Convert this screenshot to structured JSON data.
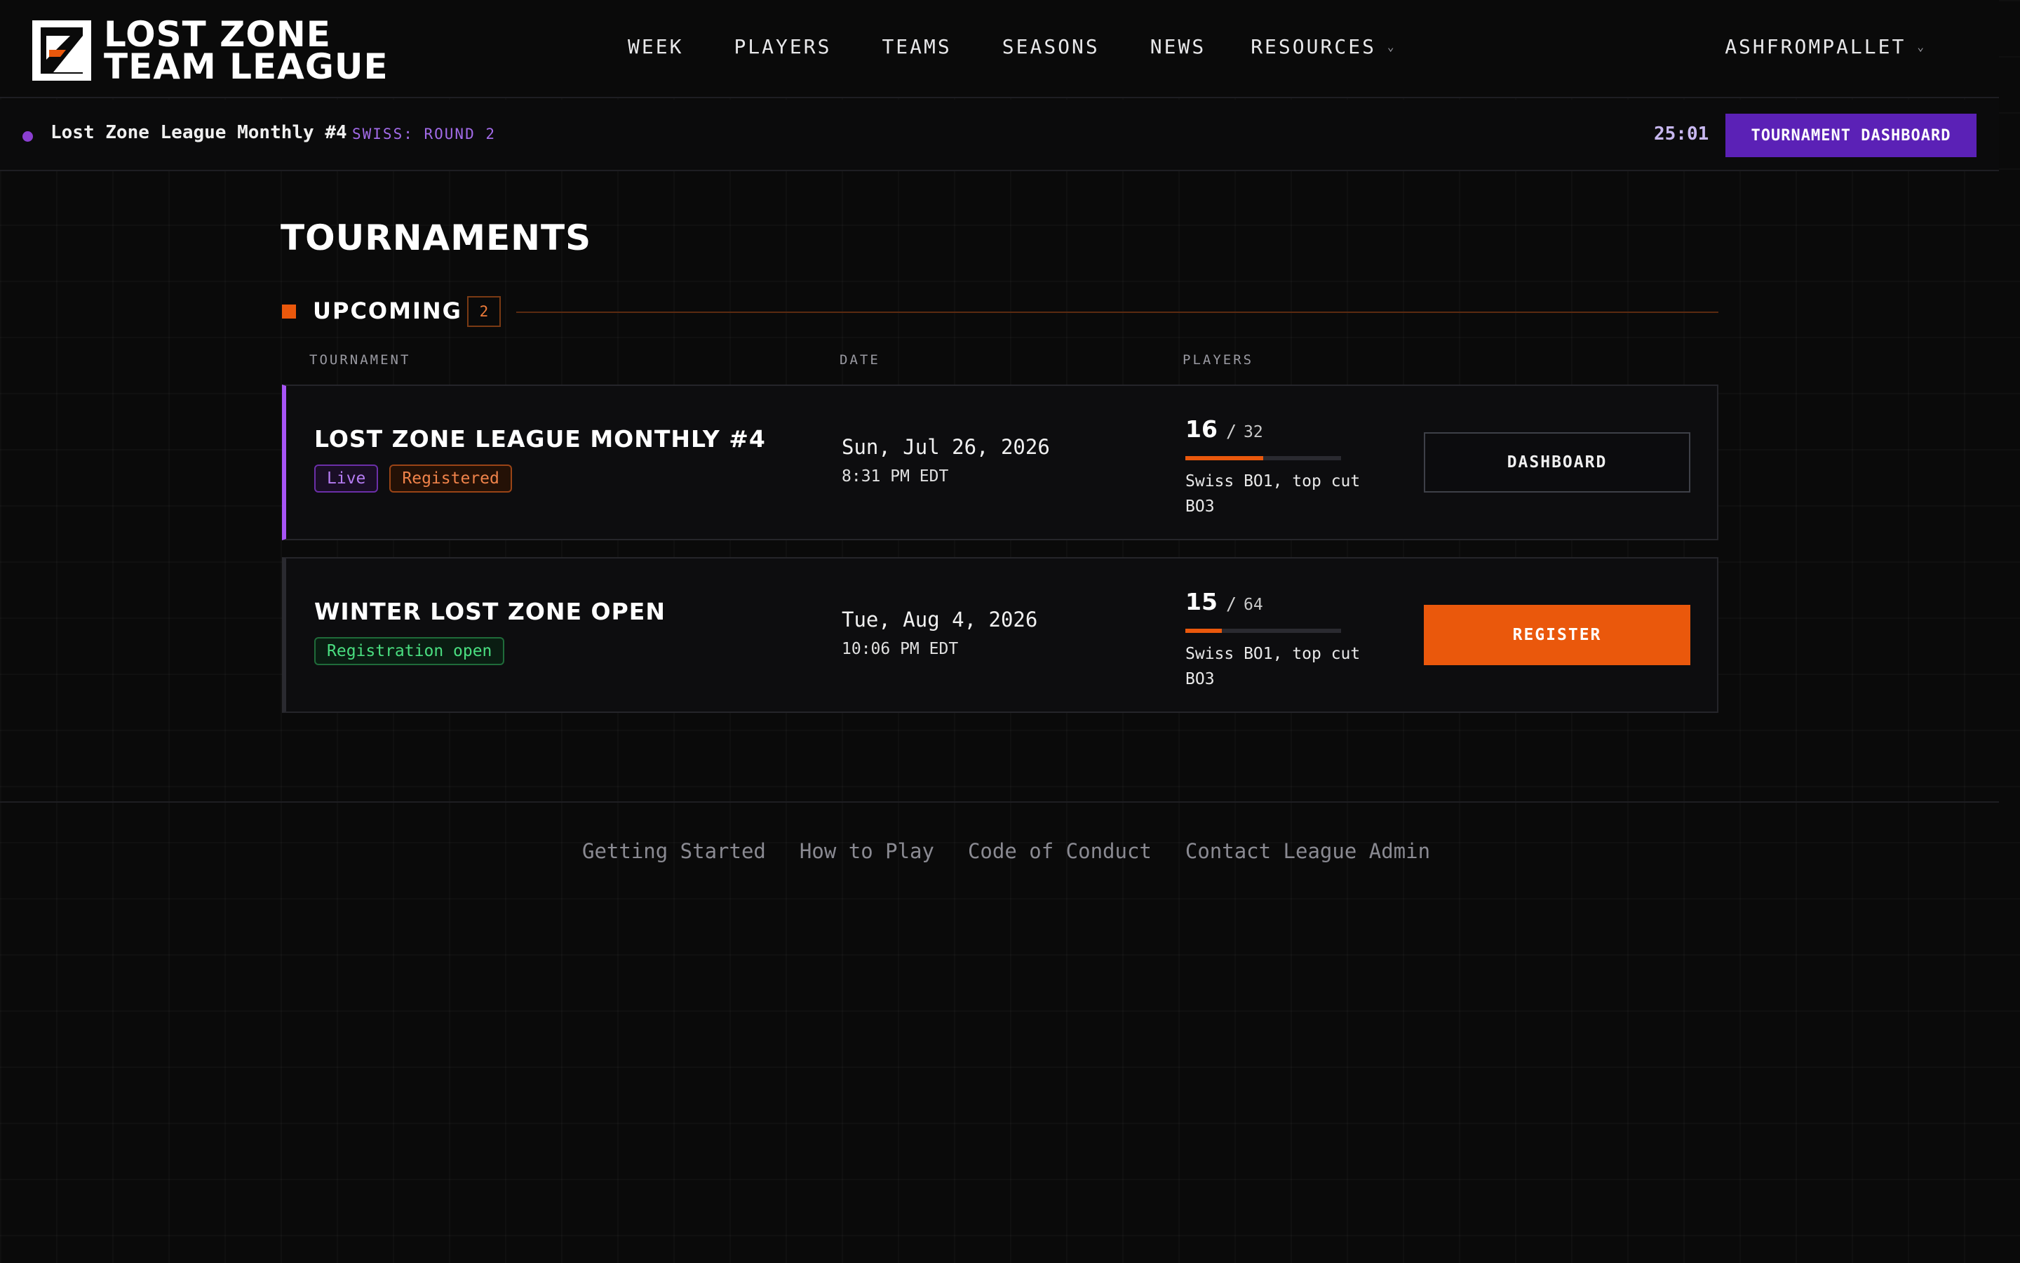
{
  "header": {
    "logo_line1": "LOST ZONE",
    "logo_line2": "TEAM LEAGUE",
    "nav": [
      "WEEK",
      "PLAYERS",
      "TEAMS",
      "SEASONS",
      "NEWS"
    ],
    "resources_label": "RESOURCES",
    "username": "ASHFROMPALLET"
  },
  "live_bar": {
    "tournament": "Lost Zone League Monthly #4",
    "round": "SWISS: ROUND 2",
    "timer": "25:01",
    "button": "TOURNAMENT DASHBOARD"
  },
  "main": {
    "title": "TOURNAMENTS",
    "section": "UPCOMING",
    "count": "2",
    "columns": [
      "TOURNAMENT",
      "DATE",
      "PLAYERS"
    ],
    "rows": [
      {
        "name": "LOST ZONE LEAGUE MONTHLY #4",
        "tags": [
          "Live",
          "Registered"
        ],
        "date": "Sun, Jul 26, 2026",
        "time": "8:31 PM EDT",
        "players": "16",
        "sep": "/",
        "capacity": "32",
        "fill_fraction": 0.5,
        "format": "Swiss BO1, top cut BO3",
        "action": "DASHBOARD"
      },
      {
        "name": "WINTER LOST ZONE OPEN",
        "tags": [
          "Registration open"
        ],
        "date": "Tue, Aug 4, 2026",
        "time": "10:06 PM EDT",
        "players": "15",
        "sep": "/",
        "capacity": "64",
        "fill_fraction": 0.234,
        "format": "Swiss BO1, top cut BO3",
        "action": "REGISTER"
      }
    ]
  },
  "footer": {
    "links": [
      "Getting Started",
      "How to Play",
      "Code of Conduct",
      "Contact League Admin"
    ]
  },
  "colors": {
    "accent_orange": "#ea580c",
    "accent_purple": "#5b21b6",
    "live_purple": "#a855f7",
    "open_green": "#4ade80",
    "background": "#0a0a0a"
  },
  "icons": [
    "logo-mark-icon",
    "chevron-down-icon",
    "live-dot-icon"
  ]
}
